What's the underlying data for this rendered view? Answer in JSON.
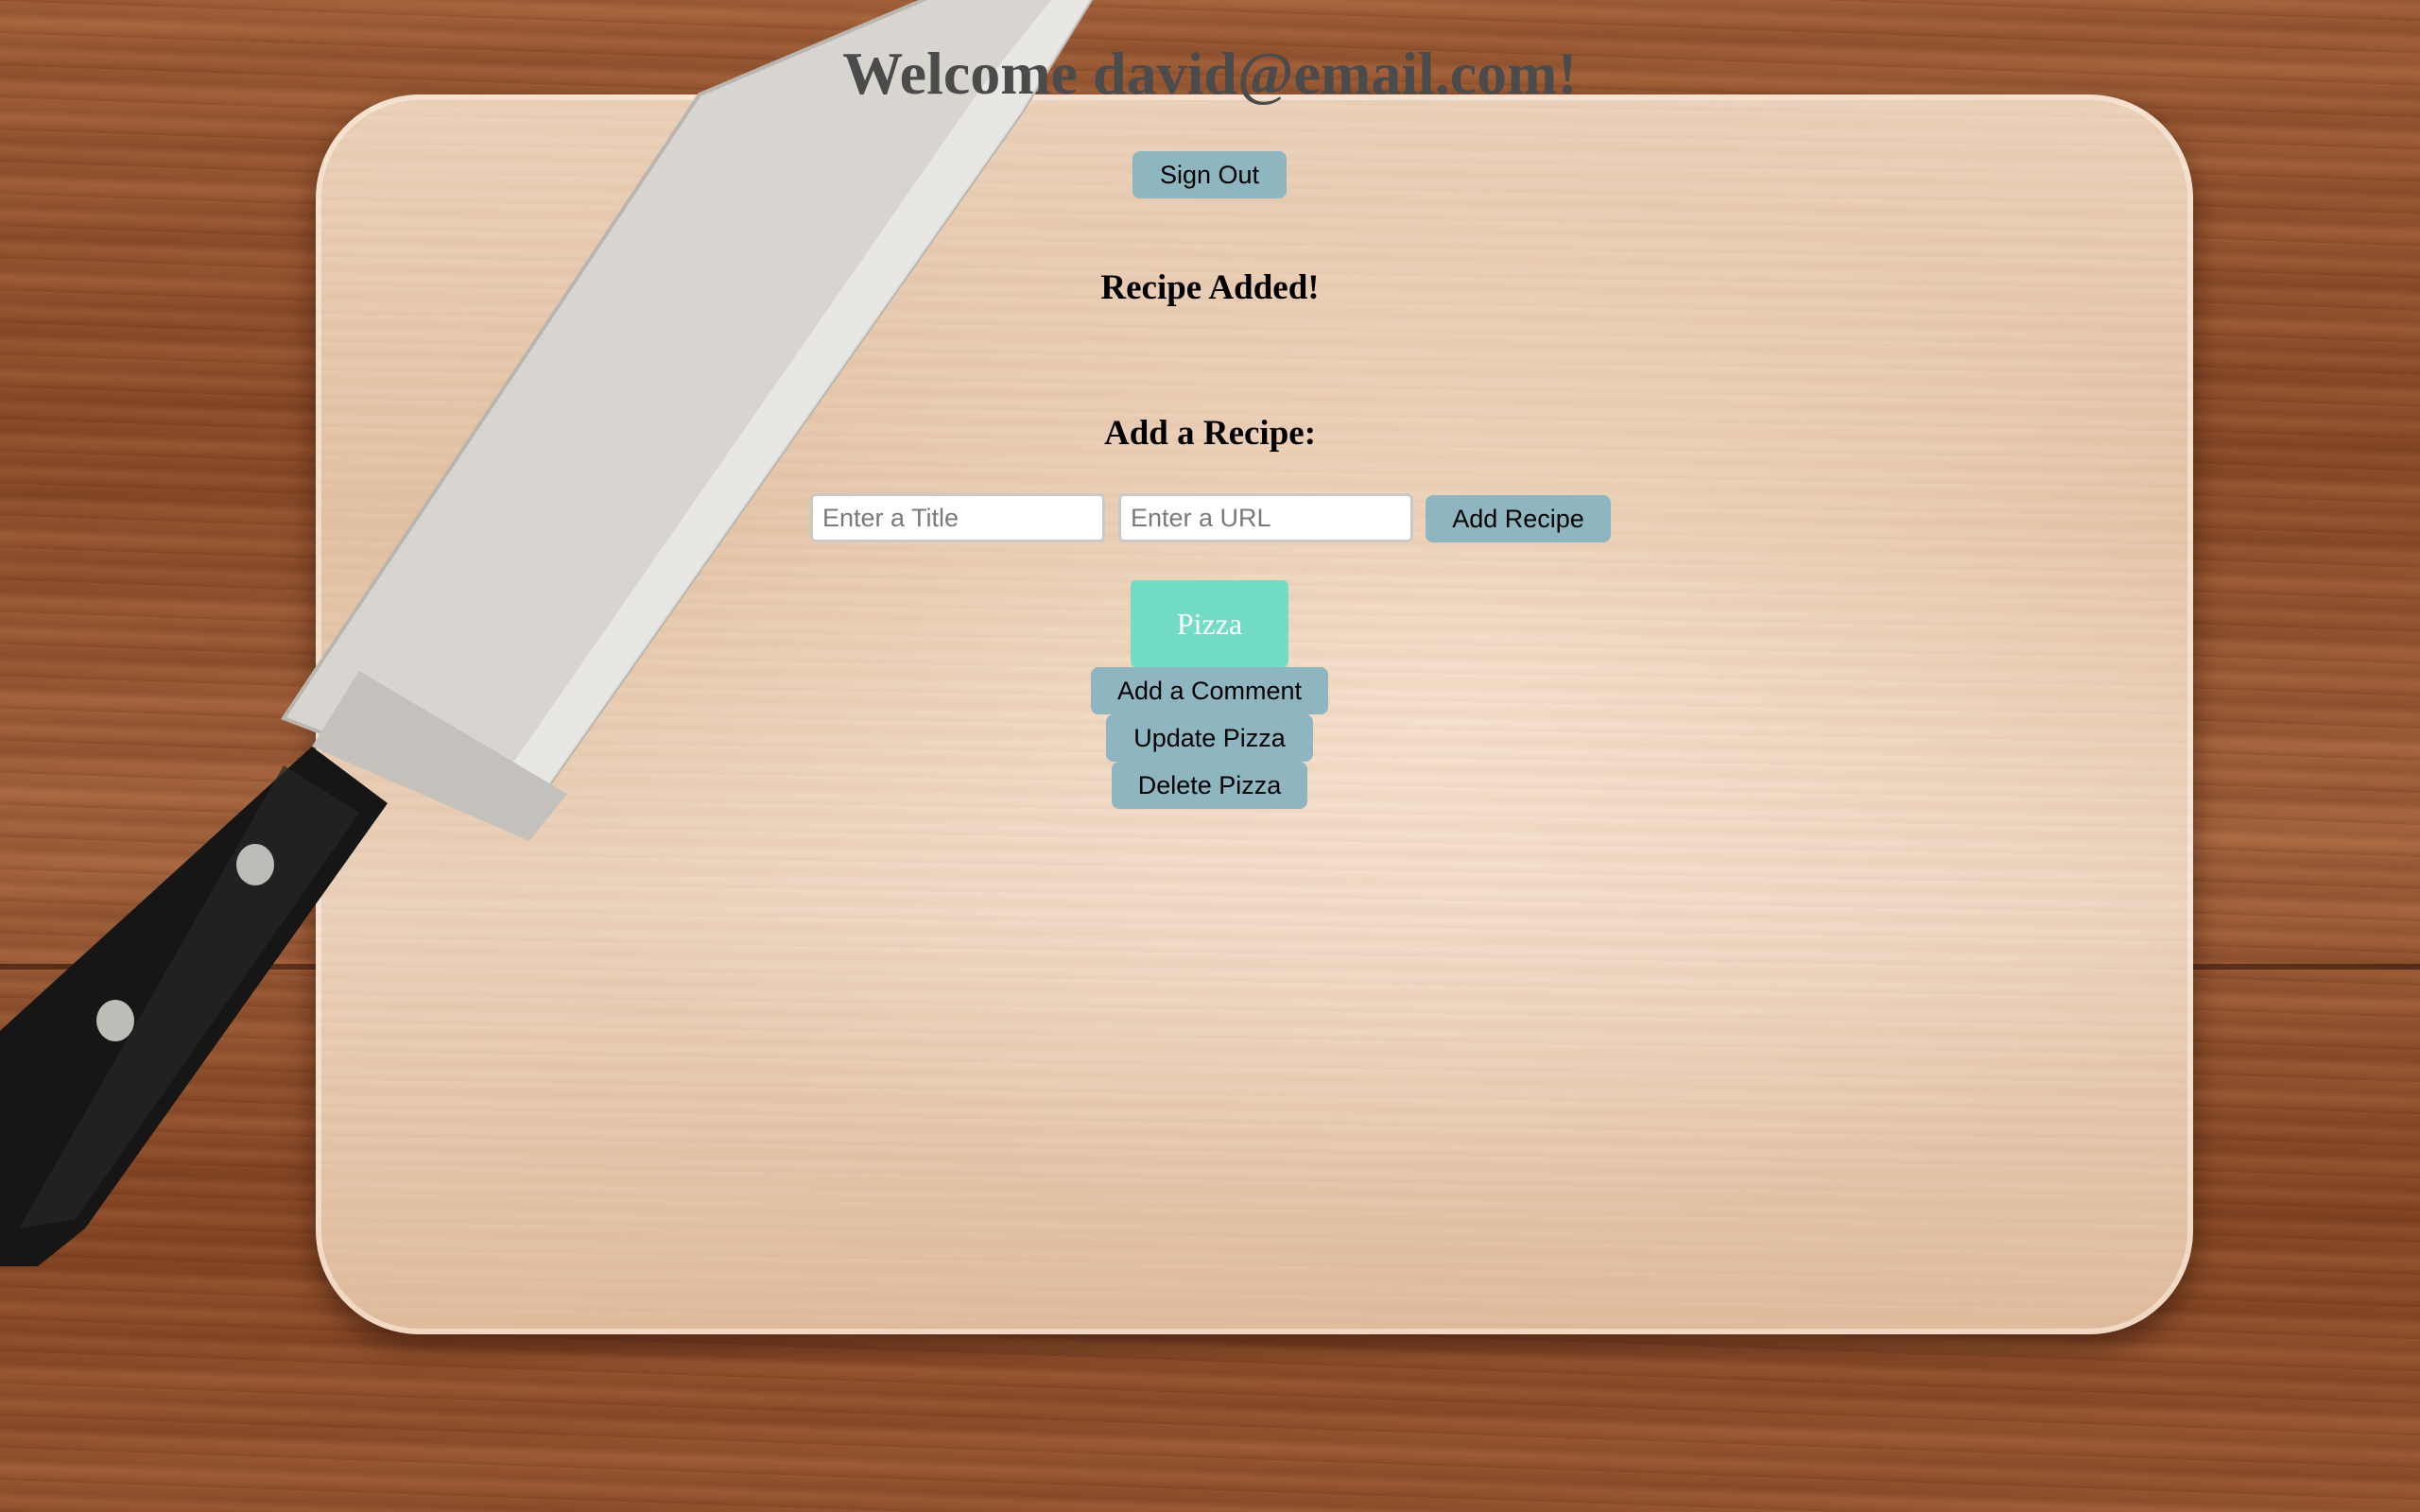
{
  "header": {
    "welcome_text": "Welcome david@email.com!",
    "sign_out_label": "Sign Out"
  },
  "status": {
    "message": "Recipe Added!"
  },
  "add_recipe": {
    "heading": "Add a Recipe:",
    "title_placeholder": "Enter a Title",
    "title_value": "",
    "url_placeholder": "Enter a URL",
    "url_value": "",
    "submit_label": "Add Recipe"
  },
  "recipes": [
    {
      "title": "Pizza",
      "comment_label": "Add a Comment",
      "update_label": "Update Pizza",
      "delete_label": "Delete Pizza"
    }
  ],
  "colors": {
    "button_bg": "#8db6c0",
    "recipe_card_bg": "#73dcc5",
    "welcome_text": "#4b4b4b"
  },
  "background": {
    "scene": "wooden-cutting-board-with-chef-knife"
  }
}
